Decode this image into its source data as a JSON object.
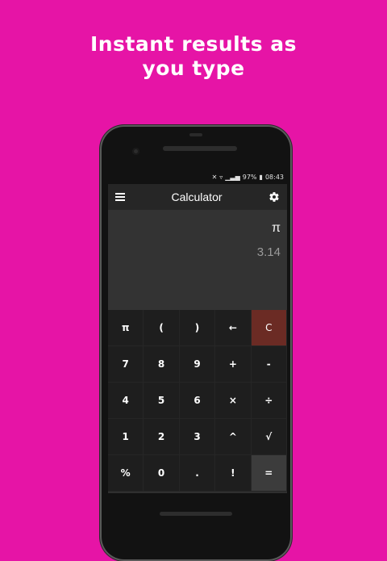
{
  "headline": {
    "line1": "Instant results as",
    "line2": "you type"
  },
  "status_bar": {
    "battery": "97%",
    "time": "08:43"
  },
  "app_bar": {
    "title": "Calculator",
    "menu_icon": "hamburger-menu-icon",
    "settings_icon": "gear-icon"
  },
  "display": {
    "expression": "π",
    "result": "3.14"
  },
  "keypad": {
    "rows": [
      [
        "π",
        "(",
        ")",
        "←",
        "C"
      ],
      [
        "7",
        "8",
        "9",
        "+",
        "-"
      ],
      [
        "4",
        "5",
        "6",
        "×",
        "÷"
      ],
      [
        "1",
        "2",
        "3",
        "^",
        "√"
      ],
      [
        "%",
        "0",
        ".",
        "!",
        "="
      ]
    ]
  },
  "colors": {
    "background": "#e614a6",
    "clear_key": "#6b2b24",
    "equals_key": "#3c3c3c"
  }
}
